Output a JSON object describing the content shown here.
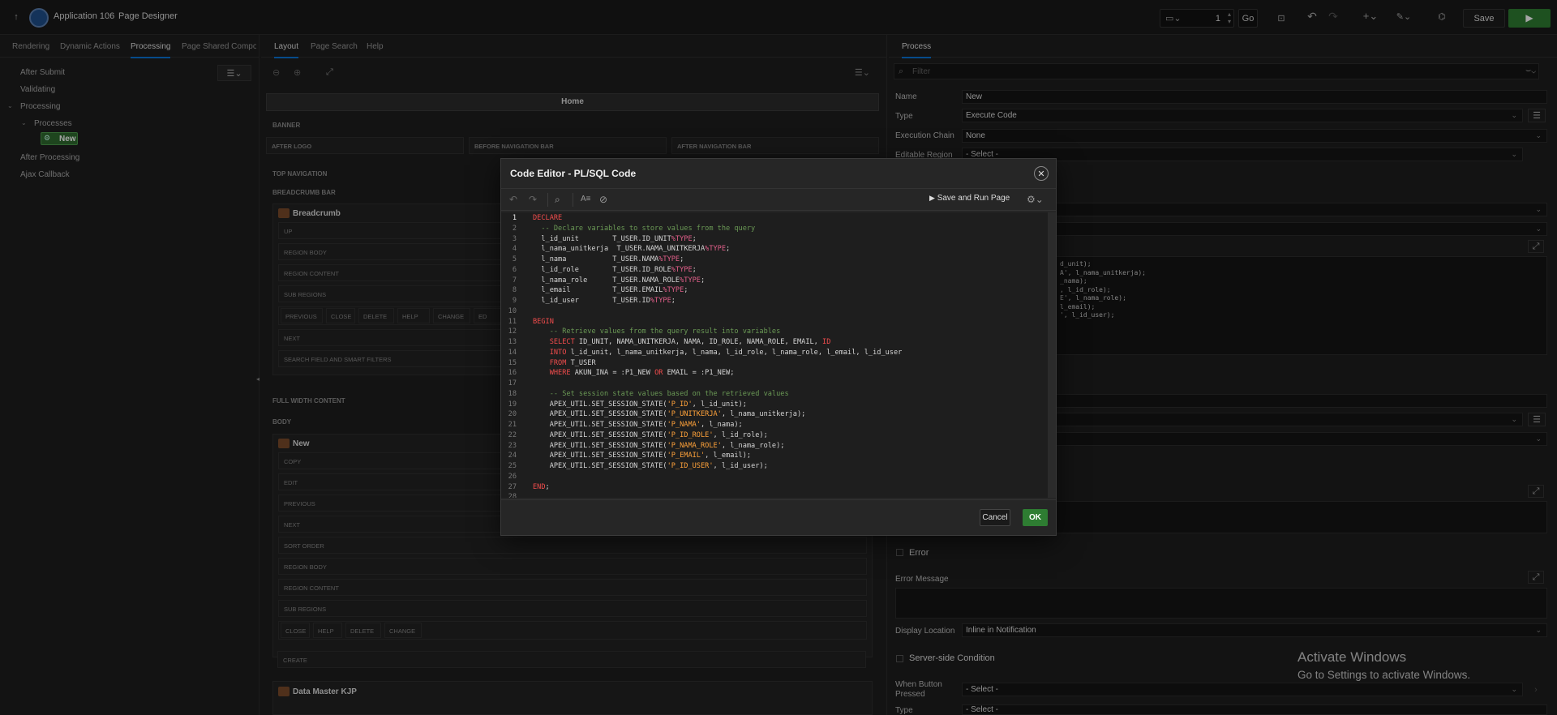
{
  "header": {
    "app_name": "Application 106",
    "page_designer": "Page Designer",
    "page_number": "1",
    "go_label": "Go",
    "save_label": "Save"
  },
  "left": {
    "tabs": [
      "Rendering",
      "Dynamic Actions",
      "Processing",
      "Page Shared Compone"
    ],
    "tree": [
      "After Submit",
      "Validating",
      "Processing",
      "Processes",
      "New",
      "After Processing",
      "Ajax Callback"
    ]
  },
  "center": {
    "tabs": [
      "Layout",
      "Page Search",
      "Help"
    ],
    "page_title": "Home",
    "sections": [
      "BANNER",
      "AFTER LOGO",
      "BEFORE NAVIGATION BAR",
      "AFTER NAVIGATION BAR",
      "TOP NAVIGATION",
      "BREADCRUMB BAR",
      "FULL WIDTH CONTENT",
      "BODY"
    ],
    "breadcrumb_region": "Breadcrumb",
    "breadcrumb_slots": [
      "UP",
      "REGION BODY",
      "REGION CONTENT",
      "SUB REGIONS",
      "NEXT",
      "SEARCH FIELD AND SMART FILTERS"
    ],
    "breadcrumb_buttons": [
      "PREVIOUS",
      "CLOSE",
      "DELETE",
      "HELP",
      "CHANGE",
      "ED"
    ],
    "new_region": "New",
    "new_slots": [
      "COPY",
      "EDIT",
      "PREVIOUS",
      "NEXT",
      "SORT ORDER",
      "REGION BODY",
      "REGION CONTENT",
      "SUB REGIONS"
    ],
    "new_buttons": [
      "CLOSE",
      "HELP",
      "DELETE",
      "CHANGE"
    ],
    "create_slot": "CREATE",
    "data_master": "Data Master KJP"
  },
  "right": {
    "tab": "Process",
    "filter_placeholder": "Filter",
    "props": [
      {
        "label": "Name",
        "value": "New"
      },
      {
        "label": "Type",
        "value": "Execute Code"
      },
      {
        "label": "Execution Chain",
        "value": "None"
      },
      {
        "label": "Editable Region",
        "value": "- Select -"
      }
    ],
    "code_peek": [
      "d_unit);",
      "A', l_nama_unitkerja);",
      "_nama);",
      ", l_id_role);",
      "E', l_nama_role);",
      "l_email);",
      "', l_id_user);"
    ],
    "error_label": "Error",
    "error_message_label": "Error Message",
    "display_location_label": "Display Location",
    "display_location_value": "Inline in Notification",
    "server_side_label": "Server-side Condition",
    "when_button_label": "When Button Pressed",
    "when_button_value": "- Select -",
    "type_label2": "Type",
    "type_value2": "- Select -"
  },
  "dialog": {
    "title": "Code Editor - PL/SQL Code",
    "save_run": "Save and Run Page",
    "cancel": "Cancel",
    "ok": "OK",
    "line_numbers": [
      "1",
      "2",
      "3",
      "4",
      "5",
      "6",
      "7",
      "8",
      "9",
      "10",
      "11",
      "12",
      "13",
      "14",
      "15",
      "16",
      "17",
      "18",
      "19",
      "20",
      "21",
      "22",
      "23",
      "24",
      "25",
      "26",
      "27",
      "28"
    ]
  },
  "watermark": {
    "title": "Activate Windows",
    "subtitle": "Go to Settings to activate Windows."
  },
  "colors": {
    "accent": "#0a74d5",
    "ok": "#2e7d32",
    "keyword": "#f14c4c",
    "comment": "#6a9955",
    "string": "#ffa23a"
  }
}
